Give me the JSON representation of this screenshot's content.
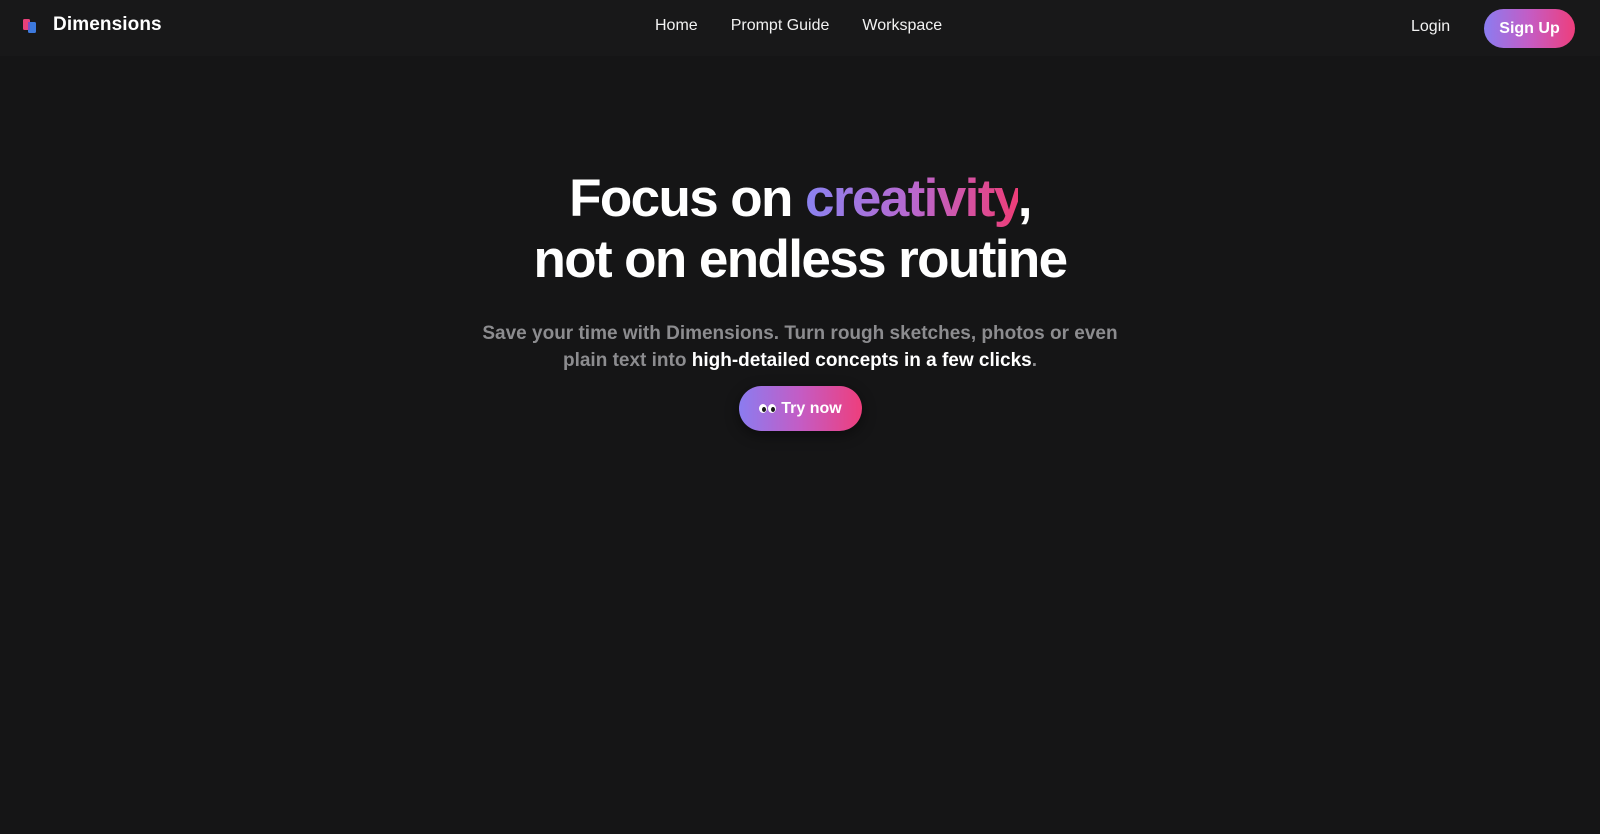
{
  "brand": {
    "name": "Dimensions",
    "logo_icon": "dimensions-logo-icon"
  },
  "nav": {
    "items": [
      {
        "label": "Home"
      },
      {
        "label": "Prompt Guide"
      },
      {
        "label": "Workspace"
      }
    ],
    "login_label": "Login",
    "signup_label": "Sign Up"
  },
  "hero": {
    "title_part1": "Focus on ",
    "title_highlight": "creativity",
    "title_part2": ",",
    "title_line2": "not on endless routine",
    "subtitle_line1": "Save your time with Dimensions. Turn rough sketches, photos or even",
    "subtitle_line2_prefix": "plain text into ",
    "subtitle_highlight": "high-detailed concepts in a few clicks",
    "subtitle_suffix": ".",
    "cta_label": "Try now",
    "cta_icon": "eyes-icon"
  },
  "colors": {
    "background": "#151516",
    "navbar": "#181819",
    "gradient_start": "#8b7cf0",
    "gradient_mid": "#c45cc4",
    "gradient_end": "#ee3e7c",
    "muted_text": "#8c8c8f"
  }
}
